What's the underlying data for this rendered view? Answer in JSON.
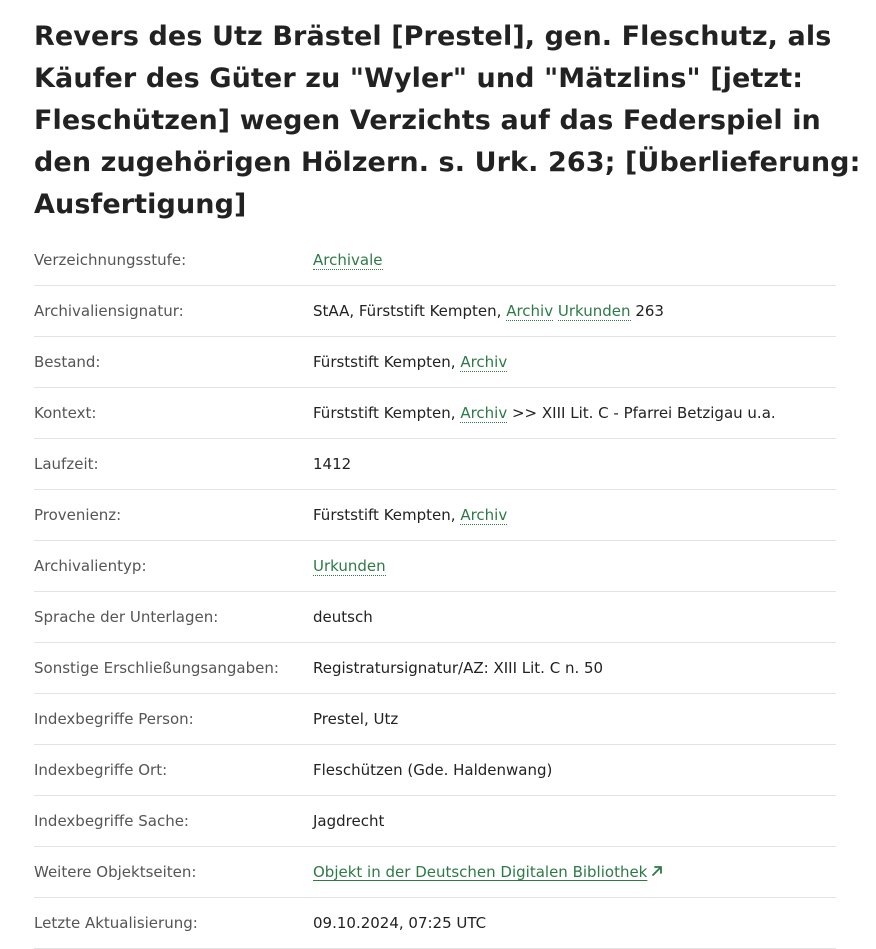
{
  "title": "Revers des Utz Brästel [Prestel], gen. Fleschutz, als Käufer des Güter zu \"Wyler\" und \"Mätzlins\" [jetzt: Fleschützen] wegen Verzichts auf das Federspiel in den zugehörigen Hölzern. s. Urk. 263; [Überlieferung: Ausfertigung]",
  "rows": {
    "verzeichnungsstufe": {
      "label": "Verzeichnungsstufe:",
      "link": "Archivale"
    },
    "signatur": {
      "label": "Archivaliensignatur:",
      "prefix": "StAA, Fürststift Kempten, ",
      "link1": "Archiv",
      "link2": "Urkunden",
      "suffix": " 263"
    },
    "bestand": {
      "label": "Bestand:",
      "prefix": "Fürststift Kempten, ",
      "link": "Archiv"
    },
    "kontext": {
      "label": "Kontext:",
      "prefix": "Fürststift Kempten, ",
      "link": "Archiv",
      "suffix": " >> XIII Lit. C - Pfarrei Betzigau u.a."
    },
    "laufzeit": {
      "label": "Laufzeit:",
      "value": "1412"
    },
    "provenienz": {
      "label": "Provenienz:",
      "prefix": "Fürststift Kempten, ",
      "link": "Archiv"
    },
    "archivalientyp": {
      "label": "Archivalientyp:",
      "link": "Urkunden"
    },
    "sprache": {
      "label": "Sprache der Unterlagen:",
      "value": "deutsch"
    },
    "sonstige": {
      "label": "Sonstige Erschließungsangaben:",
      "value": "Registratursignatur/AZ: XIII Lit. C n. 50"
    },
    "person": {
      "label": "Indexbegriffe Person:",
      "value": "Prestel, Utz"
    },
    "ort": {
      "label": "Indexbegriffe Ort:",
      "value": "Fleschützen (Gde. Haldenwang)"
    },
    "sache": {
      "label": "Indexbegriffe Sache:",
      "value": "Jagdrecht"
    },
    "weitere": {
      "label": "Weitere Objektseiten:",
      "link": "Objekt in der Deutschen Digitalen Bibliothek"
    },
    "aktualisierung": {
      "label": "Letzte Aktualisierung:",
      "value": "09.10.2024, 07:25 UTC"
    }
  },
  "icons": {
    "external_link": "arrow-up-right-icon"
  },
  "colors": {
    "link": "#2d7a48",
    "divider": "#e3e3e3",
    "label": "#555555",
    "text": "#222222"
  }
}
